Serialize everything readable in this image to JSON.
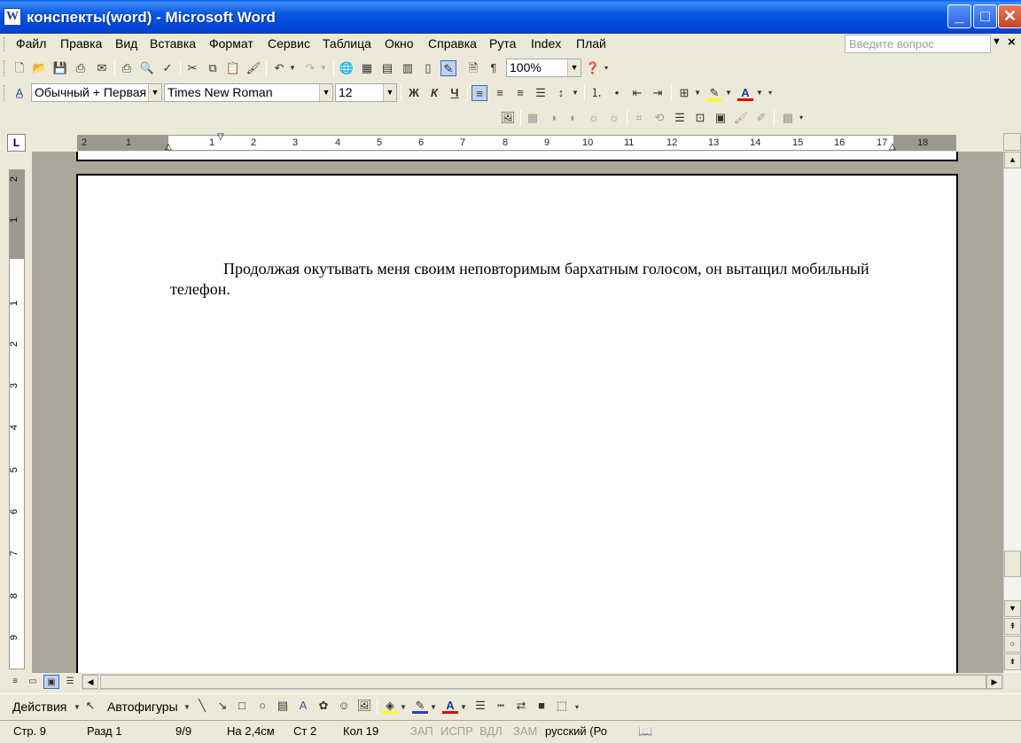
{
  "window": {
    "title": "конспекты(word) - Microsoft Word"
  },
  "menu": {
    "items": [
      "Файл",
      "Правка",
      "Вид",
      "Вставка",
      "Формат",
      "Сервис",
      "Таблица",
      "Окно",
      "Справка",
      "Рута",
      "Index",
      "Плай"
    ],
    "ask_placeholder": "Введите вопрос"
  },
  "toolbar": {
    "zoom": "100%",
    "style": "Обычный + Первая",
    "font": "Times New Roman",
    "size": "12",
    "bold": "Ж",
    "italic": "К",
    "underline": "Ч",
    "pilcrow": "¶"
  },
  "ruler": {
    "corner": "L",
    "ticks": [
      "2",
      "1",
      "1",
      "2",
      "3",
      "4",
      "5",
      "6",
      "7",
      "8",
      "9",
      "10",
      "11",
      "12",
      "13",
      "14",
      "15",
      "16",
      "17",
      "18"
    ],
    "vticks": [
      "2",
      "1",
      "1",
      "2",
      "3",
      "4",
      "5",
      "6",
      "7",
      "8",
      "9"
    ]
  },
  "document": {
    "paragraph": "Продолжая окутывать меня своим неповторимым бархатным голосом, он вытащил мобильный телефон."
  },
  "drawing": {
    "actions": "Действия",
    "autoshapes": "Автофигуры"
  },
  "status": {
    "page": "Стр. 9",
    "section": "Разд 1",
    "pages": "9/9",
    "at": "На 2,4см",
    "line": "Ст 2",
    "col": "Кол 19",
    "rec": "ЗАП",
    "trk": "ИСПР",
    "ext": "ВДЛ",
    "ovr": "ЗАМ",
    "lang": "русский (Ро"
  }
}
